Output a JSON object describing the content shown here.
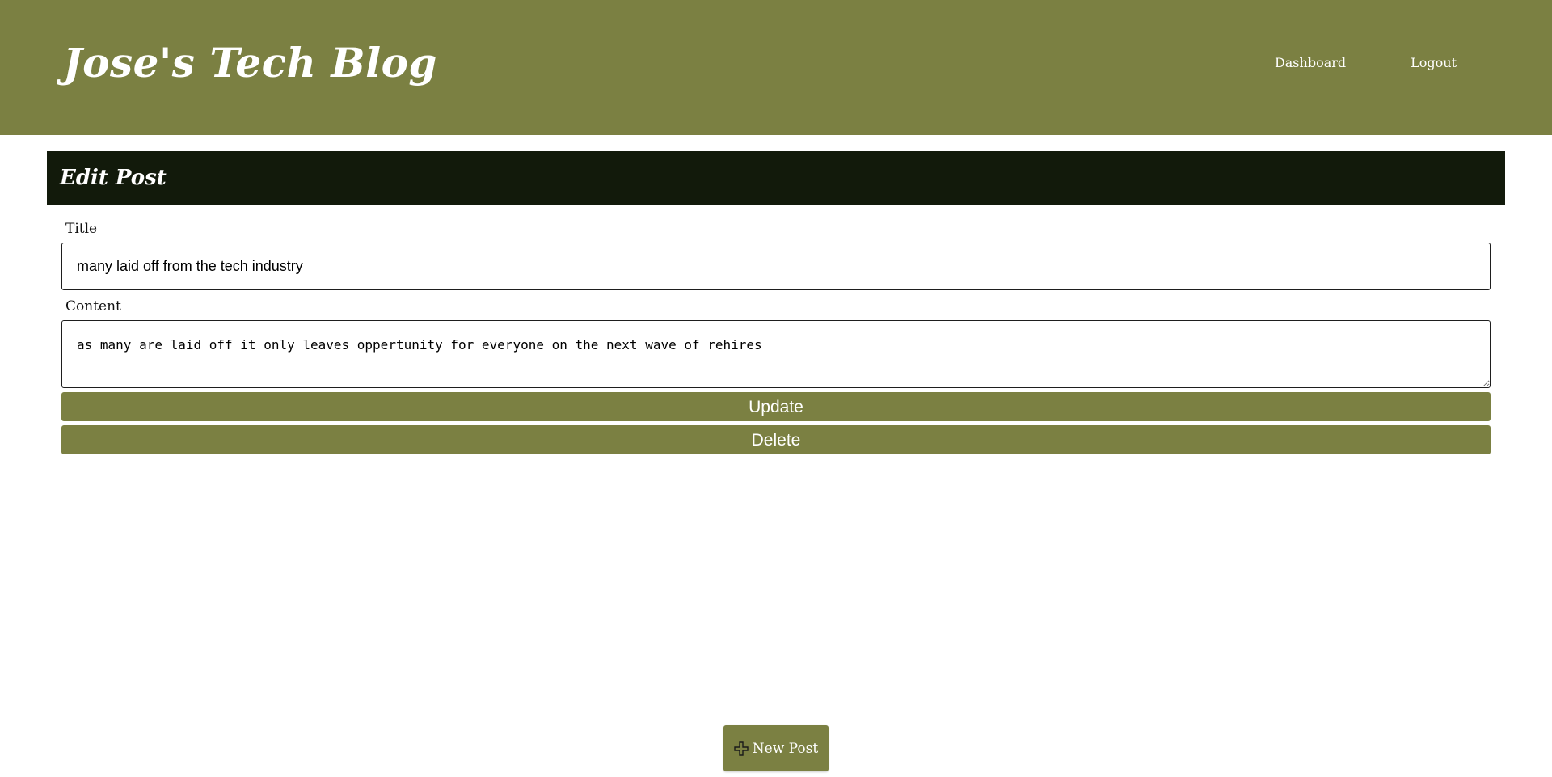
{
  "header": {
    "site_title": "Jose's Tech Blog",
    "nav": {
      "dashboard": "Dashboard",
      "logout": "Logout"
    }
  },
  "edit_post": {
    "heading": "Edit Post",
    "title_label": "Title",
    "title_value": "many laid off from the tech industry",
    "content_label": "Content",
    "content_value": "as many are laid off it only leaves oppertunity for everyone on the next wave of rehires",
    "update_label": "Update",
    "delete_label": "Delete"
  },
  "new_post": {
    "label": "New Post",
    "icon": "plus-icon"
  },
  "colors": {
    "accent": "#7b8042",
    "panel_header": "#121a0b",
    "text_on_accent": "#ffffff"
  }
}
